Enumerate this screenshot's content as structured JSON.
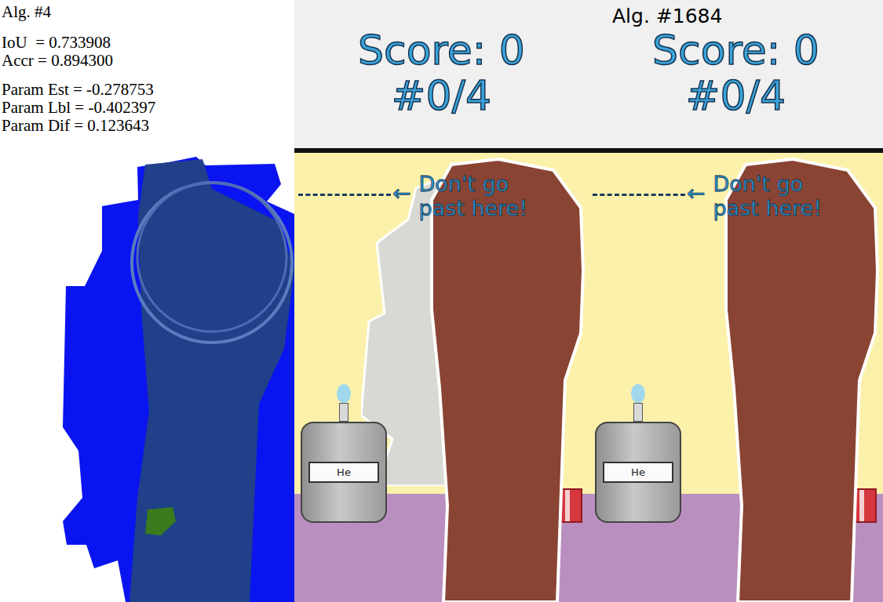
{
  "analysis": {
    "title": "Alg. #4",
    "metrics": [
      "IoU  = 0.733908",
      "Accr = 0.894300"
    ],
    "params": [
      "Param Est = -0.278753",
      "Param Lbl = -0.402397",
      "Param Dif = 0.123643"
    ]
  },
  "header": {
    "title": "Alg. #1684"
  },
  "players": [
    {
      "score": "Score: 0",
      "progress": "#0/4"
    },
    {
      "score": "Score: 0",
      "progress": "#0/4"
    }
  ],
  "games": [
    {
      "warning": [
        "Don't go",
        "past here!"
      ],
      "arrow": "←",
      "tank_label": "He",
      "ghost": true
    },
    {
      "warning": [
        "Don't go",
        "past here!"
      ],
      "arrow": "←",
      "tank_label": "He",
      "ghost": false
    }
  ]
}
